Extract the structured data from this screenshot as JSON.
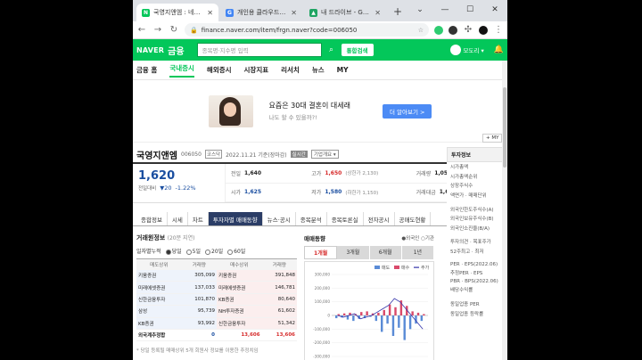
{
  "browser": {
    "tabs": [
      {
        "title": "국영지앤엠 : 네이버 금융",
        "favicon_color": "#03c75a",
        "active": true
      },
      {
        "title": "개인용 클라우드 스토리지",
        "favicon_color": "#4285f4",
        "active": false
      },
      {
        "title": "내 드라이브 - Google Drive",
        "favicon_color": "#1fa463",
        "active": false
      }
    ],
    "url": "finance.naver.com/item/frgn.naver?code=006050"
  },
  "naver": {
    "logo": "NAVER",
    "section": "금융",
    "search_placeholder": "종목명·지수명 입력",
    "search_submit": "통합검색",
    "user_name": "모도리 ▾",
    "menu": [
      "금융 홈",
      "국내증시",
      "해외증시",
      "시장지표",
      "리서치",
      "뉴스",
      "MY"
    ],
    "menu_active": "국내증시"
  },
  "banner": {
    "title": "요즘은 30대 결혼이 대세래",
    "subtitle": "나도 할 수 있을까?!",
    "button": "더 알아보기 >"
  },
  "stock": {
    "name": "국영지앤엠",
    "code": "006050",
    "market": "코스닥",
    "date": "2022.11.21 기준(장마감)",
    "tag1": "실시간",
    "tag2": "기업개요 ▾",
    "my_button": "+ MY",
    "price": "1,620",
    "compare_label": "전일대비",
    "change": "▼20",
    "change_pct": "-1.22%",
    "quote": [
      {
        "k": "전일",
        "v": "1,640",
        "s": "",
        "color": "#222"
      },
      {
        "k": "고가",
        "v": "1,650",
        "s": "(상한가 2,130)",
        "color": "#d62b2b"
      },
      {
        "k": "거래량",
        "v": "1,051,571",
        "s": "",
        "color": "#222"
      },
      {
        "k": "시가",
        "v": "1,625",
        "s": "",
        "color": "#1a4ea0"
      },
      {
        "k": "저가",
        "v": "1,580",
        "s": "(하한가 1,150)",
        "color": "#1a4ea0"
      },
      {
        "k": "거래대금",
        "v": "1,699",
        "s": "백만",
        "color": "#222"
      }
    ]
  },
  "subtabs": [
    "종합정보",
    "시세",
    "차트",
    "투자자별 매매동향",
    "뉴스·공시",
    "종목분석",
    "종목토론실",
    "전자공시",
    "공매도현황"
  ],
  "subtab_active": "투자자별 매매동향",
  "trading": {
    "title": "거래원정보",
    "subtitle": "(20분 지연)",
    "period_label": "일자별누적",
    "periods": [
      "당일",
      "5일",
      "20일",
      "60일"
    ],
    "period_active": "당일",
    "headers": [
      "매도상위",
      "거래량",
      "매수상위",
      "거래량"
    ],
    "rows": [
      [
        "키움증권",
        "305,099",
        "키움증권",
        "391,848"
      ],
      [
        "미래에셋증권",
        "137,033",
        "미래에셋증권",
        "146,781"
      ],
      [
        "신한금융투자",
        "101,870",
        "KB증권",
        "80,640"
      ],
      [
        "삼성",
        "95,739",
        "NH투자증권",
        "61,602"
      ],
      [
        "KB증권",
        "93,992",
        "신한금융투자",
        "51,342"
      ]
    ],
    "foreign": [
      "외국계추정합",
      "0",
      "13,606",
      "13,606"
    ],
    "footnote": "* 당일 등록될 매매상위 5개 회원사 정보를 이용한 추정치임"
  },
  "flow": {
    "title": "매매동향",
    "options": "●외국인 ○기관",
    "periods": [
      "1개월",
      "3개월",
      "6개월",
      "1년"
    ],
    "period_active": "1개월",
    "legend": [
      "매도",
      "매수",
      "주가"
    ]
  },
  "chart_data": {
    "type": "bar",
    "title": "",
    "ylim": [
      -300000,
      300000
    ],
    "y_ticks": [
      "300,000",
      "200,000",
      "100,000",
      "0",
      "-100,000",
      "-200,000",
      "-300,000"
    ],
    "x_ticks": [
      "10.28",
      "11.07",
      "11.15"
    ],
    "series": [
      {
        "name": "매도",
        "color": "#5a8bd6",
        "values": [
          -20000,
          -15000,
          -30000,
          -40000,
          -25000,
          -20000,
          -10000,
          -40000,
          -120000,
          -60000,
          -150000,
          -90000,
          -180000,
          -100000,
          -60000,
          -40000
        ]
      },
      {
        "name": "매수",
        "color": "#d94a6b",
        "values": [
          10000,
          15000,
          20000,
          10000,
          25000,
          30000,
          15000,
          20000,
          40000,
          80000,
          60000,
          110000,
          70000,
          30000,
          20000,
          10000
        ]
      }
    ],
    "price_line": [
      1700,
      1690,
      1700,
      1710,
      1680,
      1690,
      1700,
      1720,
      1740,
      1760,
      1800,
      1780,
      1740,
      1700,
      1660,
      1620
    ],
    "price_color": "#3333aa"
  },
  "sidebar": {
    "header": "투자정보",
    "groups": [
      [
        "시가총액",
        "시가총액순위",
        "상장주식수",
        "액면가 · 매매단위"
      ],
      [
        "외국인한도주식수(A)",
        "외국인보유주식수(B)",
        "외국인소진율(B/A)"
      ],
      [
        "투자의견 · 목표주가",
        "52주최고 · 최저"
      ],
      [
        "PER · EPS(2022.06)",
        "추정PER · EPS",
        "PBR · BPS(2022.06)",
        "배당수익률"
      ],
      [
        "동일업종 PER",
        "동일업종 등락률"
      ]
    ]
  }
}
